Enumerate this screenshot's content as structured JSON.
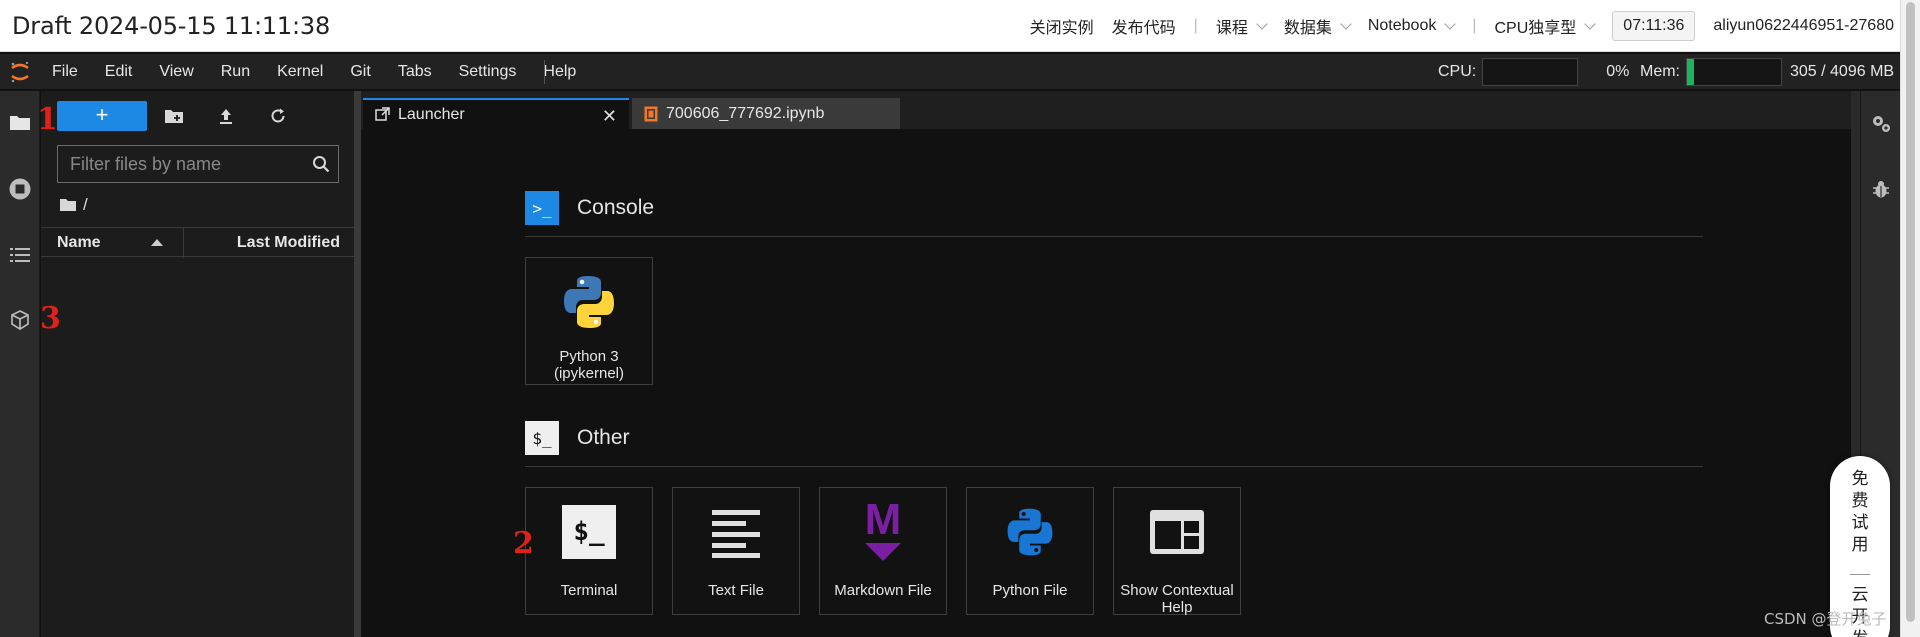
{
  "header": {
    "title": "Draft 2024-05-15 11:11:38",
    "links": [
      "关闭实例",
      "发布代码"
    ],
    "dropdowns": [
      "课程",
      "数据集",
      "Notebook"
    ],
    "instance_type": "CPU独享型",
    "time": "07:11:36",
    "user": "aliyun0622446951-27680"
  },
  "menubar": {
    "items": [
      "File",
      "Edit",
      "View",
      "Run",
      "Kernel",
      "Git",
      "Tabs",
      "Settings",
      "Help"
    ],
    "cpu_label": "CPU:",
    "cpu_value": "0%",
    "cpu_fraction": 0,
    "mem_label": "Mem:",
    "mem_value": "305 / 4096 MB",
    "mem_fraction": 0.074
  },
  "filebrowser": {
    "new_label": "+",
    "filter_placeholder": "Filter files by name",
    "path": "/",
    "col_name": "Name",
    "col_modified": "Last Modified"
  },
  "annotations": {
    "m1": "1",
    "m2": "2",
    "m3": "3"
  },
  "tabs": [
    {
      "label": "Launcher",
      "active": true,
      "close": "✕"
    },
    {
      "label": "700606_777692.ipynb",
      "active": false
    }
  ],
  "launcher": {
    "console_section": "Console",
    "console_badge": ">_",
    "other_section": "Other",
    "other_badge": "$_",
    "console_cards": [
      {
        "label": "Python 3 (ipykernel)",
        "icon": "python-logo-icon"
      }
    ],
    "other_cards": [
      {
        "label": "Terminal",
        "icon": "terminal-icon",
        "glyph": "$_"
      },
      {
        "label": "Text File",
        "icon": "text-file-icon"
      },
      {
        "label": "Markdown File",
        "icon": "markdown-icon",
        "glyph": "M"
      },
      {
        "label": "Python File",
        "icon": "python-file-icon"
      },
      {
        "label": "Show Contextual Help",
        "icon": "contextual-help-icon"
      }
    ]
  },
  "trial_badge": {
    "top": "免费试用",
    "bottom": "云开发"
  },
  "watermark": "CSDN @登开兔子",
  "colors": {
    "accent": "#1e88e5",
    "brand_orange": "#f37726",
    "mem_bar": "#1cb45a",
    "markdown_purple": "#7b1fa2",
    "annotation_red": "#e0201b"
  }
}
